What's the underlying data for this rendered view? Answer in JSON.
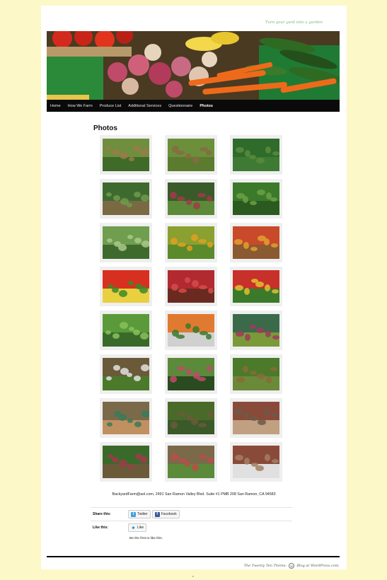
{
  "site": {
    "tagline": "Turn your yard into a garden"
  },
  "nav": {
    "items": [
      {
        "label": "Home"
      },
      {
        "label": "How We Farm"
      },
      {
        "label": "Produce List"
      },
      {
        "label": "Additional Services"
      },
      {
        "label": "Questionnaire"
      },
      {
        "label": "Photos"
      }
    ],
    "active_index": 5
  },
  "page": {
    "title": "Photos"
  },
  "gallery": {
    "photos": [
      {
        "colors": [
          "#6f8f3e",
          "#9c7a4a",
          "#3f6a28"
        ]
      },
      {
        "colors": [
          "#6b8f3a",
          "#8a6a44",
          "#5b7b2e"
        ]
      },
      {
        "colors": [
          "#2f6b2a",
          "#5a8a3e",
          "#3e7a34"
        ]
      },
      {
        "colors": [
          "#3e6a30",
          "#6f9a4a",
          "#7a6a44"
        ]
      },
      {
        "colors": [
          "#3a5a2a",
          "#a23a4a",
          "#5c8a38"
        ]
      },
      {
        "colors": [
          "#3a7a2a",
          "#6ea044",
          "#2a5a20"
        ]
      },
      {
        "colors": [
          "#6e9e4e",
          "#aac88a",
          "#3f6a2e"
        ]
      },
      {
        "colors": [
          "#8aa030",
          "#e0a020",
          "#5a8a2a"
        ]
      },
      {
        "colors": [
          "#c84a2a",
          "#e0a030",
          "#8a5a30"
        ]
      },
      {
        "colors": [
          "#d83020",
          "#3a8a2a",
          "#e8d040"
        ]
      },
      {
        "colors": [
          "#b02a30",
          "#d84a4a",
          "#6a2a20"
        ]
      },
      {
        "colors": [
          "#c8302a",
          "#e0c030",
          "#3a7a2a"
        ]
      },
      {
        "colors": [
          "#5a9a3a",
          "#8ac05a",
          "#3a6a2a"
        ]
      },
      {
        "colors": [
          "#e07a30",
          "#3a7a2a",
          "#d0d0d0"
        ]
      },
      {
        "colors": [
          "#3a6a4a",
          "#a03a5a",
          "#7a9a3a"
        ]
      },
      {
        "colors": [
          "#6a5a3a",
          "#e0e0e0",
          "#4a7a2a"
        ]
      },
      {
        "colors": [
          "#5a8a3a",
          "#c04a6a",
          "#2a4a20"
        ]
      },
      {
        "colors": [
          "#4a7a2a",
          "#8a6a3a",
          "#6a8a3a"
        ]
      },
      {
        "colors": [
          "#7a6a4a",
          "#3a7a5a",
          "#c09060"
        ]
      },
      {
        "colors": [
          "#4a6a2a",
          "#6a5a3a",
          "#3a5a2a"
        ]
      },
      {
        "colors": [
          "#8a4a3a",
          "#6a5a4a",
          "#c0a080"
        ]
      },
      {
        "colors": [
          "#3a6a2a",
          "#a03a4a",
          "#6a5a3a"
        ]
      },
      {
        "colors": [
          "#7a6a4a",
          "#c04a4a",
          "#5a8a3a"
        ]
      },
      {
        "colors": [
          "#8a4a3a",
          "#a08060",
          "#e0e0e0"
        ]
      }
    ]
  },
  "caption": "BackyardFarm@aol.com, 2491 San Ramon Valley Blvd. Suite #1 PMB 208 San Ramon, CA 94583",
  "share": {
    "label": "Share this:",
    "twitter": "Twitter",
    "facebook": "Facebook",
    "twitter_icon": "twitter-icon",
    "facebook_icon": "facebook-icon"
  },
  "like": {
    "label": "Like this:",
    "button": "Like",
    "icon": "star-icon",
    "first_text": "Be the first to like this."
  },
  "footer": {
    "theme": "The Twenty Ten Theme.",
    "blog": "Blog at WordPress.com.",
    "icon": "wordpress-icon"
  },
  "bottom_mark": "x"
}
